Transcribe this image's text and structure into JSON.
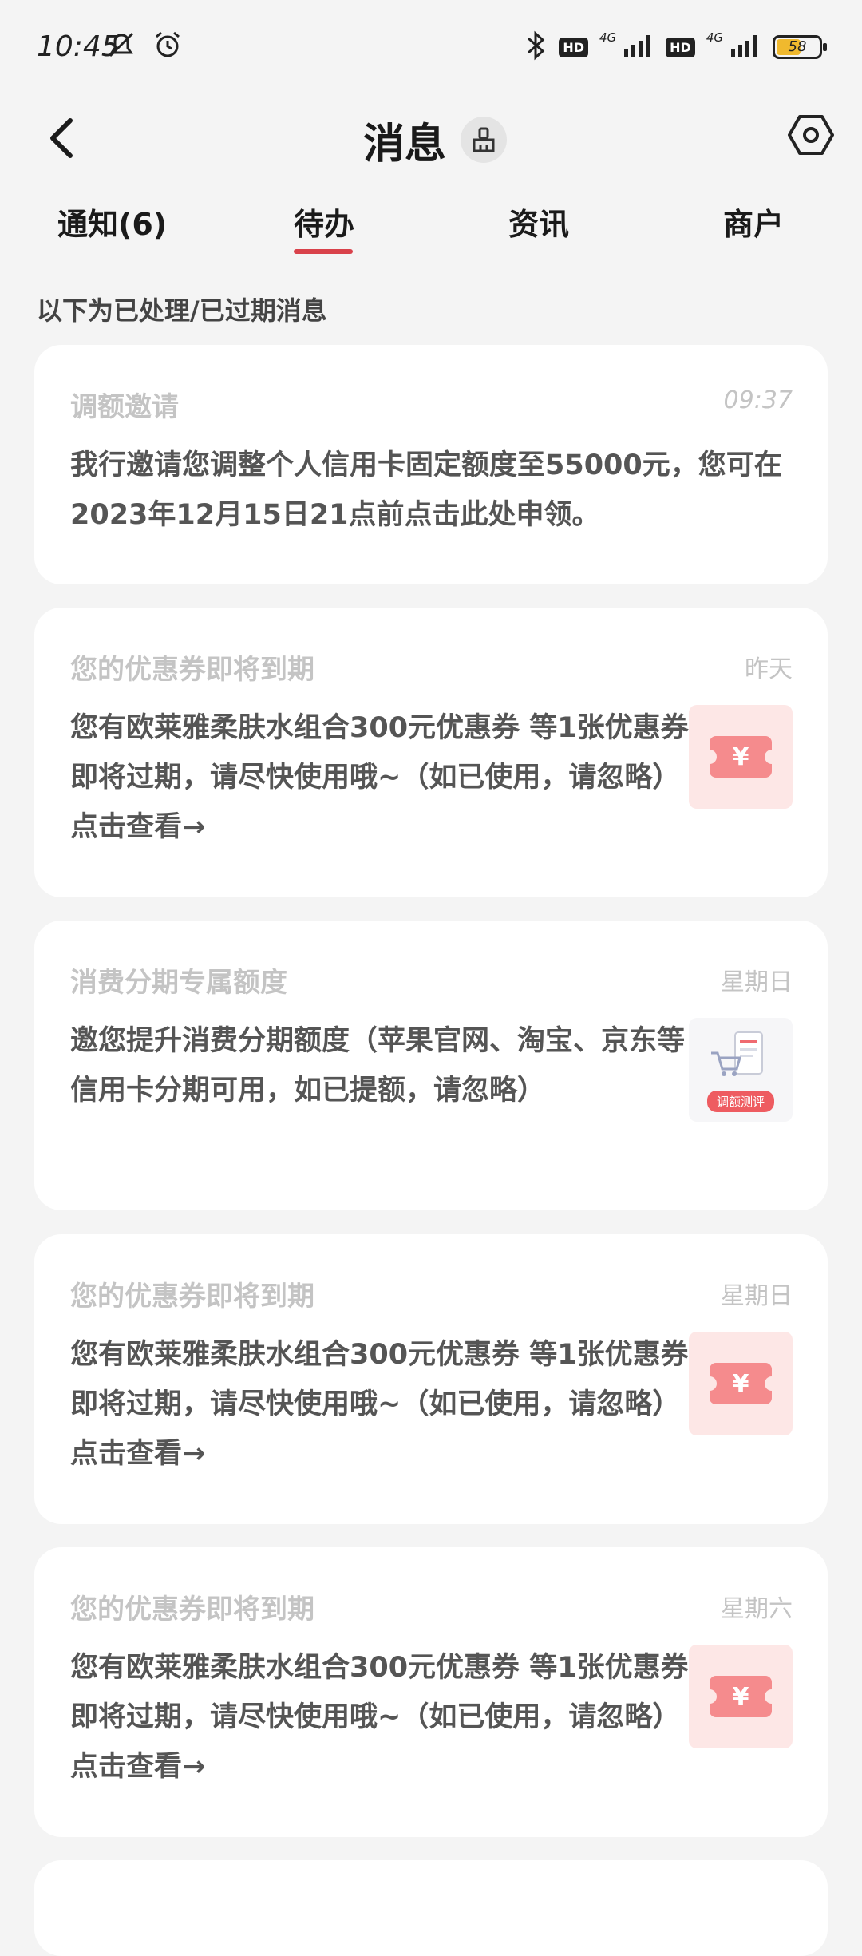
{
  "status_bar": {
    "time": "10:45",
    "network": "4G",
    "hd": "HD",
    "battery": "58"
  },
  "header": {
    "title": "消息"
  },
  "tabs": [
    {
      "label": "通知(6)",
      "active": false
    },
    {
      "label": "待办",
      "active": true
    },
    {
      "label": "资讯",
      "active": false
    },
    {
      "label": "商户",
      "active": false
    }
  ],
  "section_hint": "以下为已处理/已过期消息",
  "messages": [
    {
      "title": "调额邀请",
      "time": "09:37",
      "body": "我行邀请您调整个人信用卡固定额度至55000元，您可在2023年12月15日21点前点击此处申领。"
    },
    {
      "title": "您的优惠券即将到期",
      "time": "昨天",
      "body": "您有欧莱雅柔肤水组合300元优惠券 等1张优惠券即将过期，请尽快使用哦~（如已使用，请忽略）点击查看→",
      "thumb": "coupon-icon"
    },
    {
      "title": "消费分期专属额度",
      "time": "星期日",
      "body": "邀您提升消费分期额度（苹果官网、淘宝、京东等信用卡分期可用，如已提额，请忽略）",
      "thumb": "credit-limit-image",
      "thumb_label": "调额测评"
    },
    {
      "title": "您的优惠券即将到期",
      "time": "星期日",
      "body": "您有欧莱雅柔肤水组合300元优惠券 等1张优惠券即将过期，请尽快使用哦~（如已使用，请忽略）点击查看→",
      "thumb": "coupon-icon"
    },
    {
      "title": "您的优惠券即将到期",
      "time": "星期六",
      "body": "您有欧莱雅柔肤水组合300元优惠券 等1张优惠券即将过期，请尽快使用哦~（如已使用，请忽略）点击查看→",
      "thumb": "coupon-icon"
    }
  ],
  "colors": {
    "accent": "#d9424b",
    "coupon": "#f58b8d",
    "background": "#f4f4f4"
  }
}
